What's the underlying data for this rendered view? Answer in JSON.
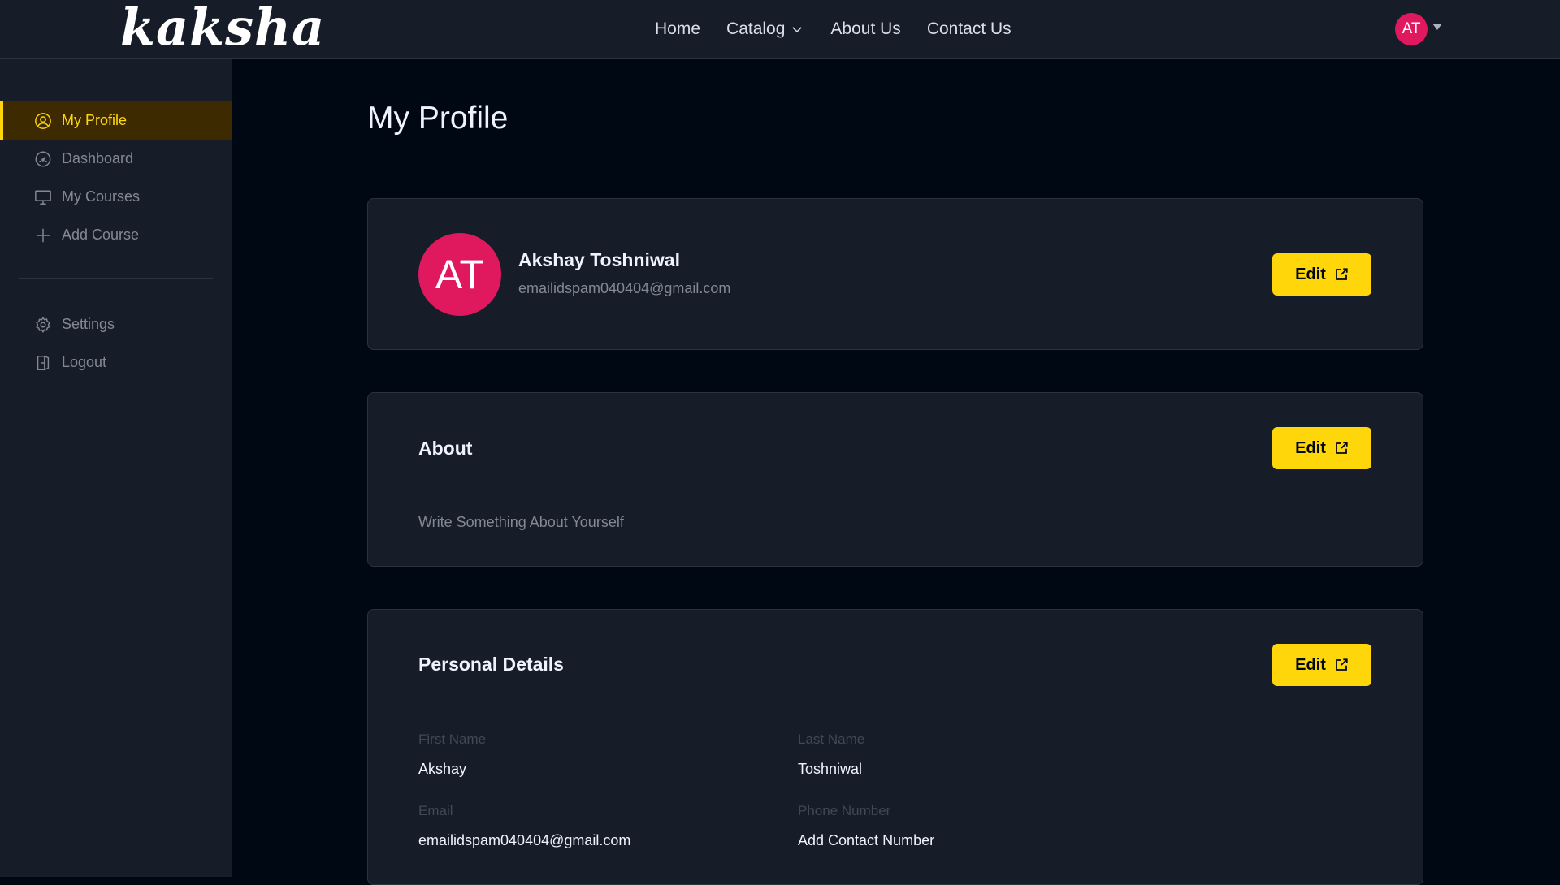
{
  "brand": {
    "logo_text": "kaksha"
  },
  "nav": {
    "items": [
      {
        "label": "Home"
      },
      {
        "label": "Catalog"
      },
      {
        "label": "About Us"
      },
      {
        "label": "Contact Us"
      }
    ],
    "avatar_initials": "AT"
  },
  "sidebar": {
    "items": [
      {
        "label": "My Profile",
        "icon": "user-circle-icon",
        "active": true
      },
      {
        "label": "Dashboard",
        "icon": "gauge-icon"
      },
      {
        "label": "My Courses",
        "icon": "monitor-icon"
      },
      {
        "label": "Add Course",
        "icon": "plus-icon"
      }
    ],
    "bottom_items": [
      {
        "label": "Settings",
        "icon": "gear-icon"
      },
      {
        "label": "Logout",
        "icon": "logout-icon"
      }
    ]
  },
  "page": {
    "title": "My Profile"
  },
  "profile_card": {
    "initials": "AT",
    "name": "Akshay Toshniwal",
    "email": "emailidspam040404@gmail.com",
    "edit_label": "Edit"
  },
  "about_card": {
    "heading": "About",
    "text": "Write Something About Yourself",
    "edit_label": "Edit"
  },
  "details_card": {
    "heading": "Personal Details",
    "edit_label": "Edit",
    "fields": {
      "first_name": {
        "label": "First Name",
        "value": "Akshay"
      },
      "last_name": {
        "label": "Last Name",
        "value": "Toshniwal"
      },
      "email": {
        "label": "Email",
        "value": "emailidspam040404@gmail.com"
      },
      "phone": {
        "label": "Phone Number",
        "value": "Add Contact Number"
      }
    }
  },
  "colors": {
    "accent": "#ffd60a",
    "avatar": "#e0195f",
    "background": "#000814",
    "surface": "#161d29"
  }
}
